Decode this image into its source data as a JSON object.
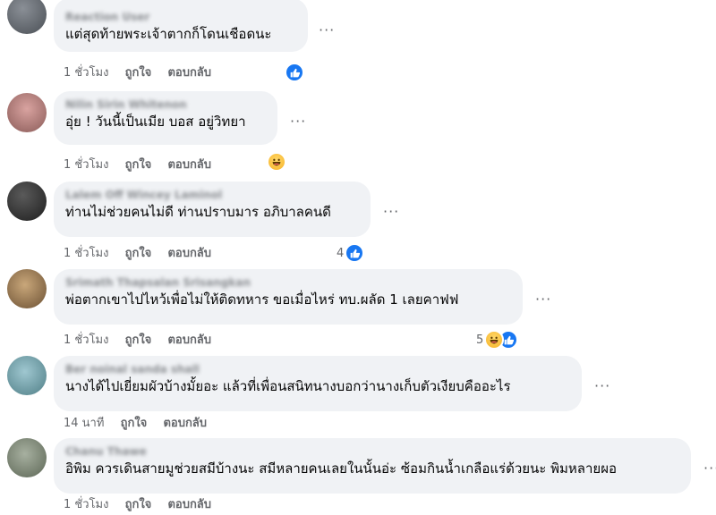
{
  "comments": [
    {
      "author": "Reaction User",
      "text": "แต่สุดท้ายพระเจ้าตากก็โดนเชือดนะ",
      "time": "1 ชั่วโมง",
      "like_label": "ถูกใจ",
      "reply_label": "ตอบกลับ",
      "reaction_count": "",
      "reactions": [
        "like"
      ]
    },
    {
      "author": "Nilin Sirin Whitenon",
      "text": "อุ่ย ! วันนี้เป็นเมีย บอส อยู่วิทยา",
      "time": "1 ชั่วโมง",
      "like_label": "ถูกใจ",
      "reply_label": "ตอบกลับ",
      "reaction_count": "",
      "reactions": [
        "haha"
      ]
    },
    {
      "author": "Lalem Off Wincey Laminol",
      "text": "ท่านไม่ช่วยคนไม่ดี ท่านปราบมาร อภิบาลคนดี",
      "time": "1 ชั่วโมง",
      "like_label": "ถูกใจ",
      "reply_label": "ตอบกลับ",
      "reaction_count": "4",
      "reactions": [
        "like"
      ]
    },
    {
      "author": "Srimath Thapsalan Srisangkan",
      "text": "พ่อตากเขาไปไหว้เพื่อไม่ให้ติดทหาร ขอเมื่อไหร่ ทบ.ผลัด 1 เลยคาฟฟ",
      "time": "1 ชั่วโมง",
      "like_label": "ถูกใจ",
      "reply_label": "ตอบกลับ",
      "reaction_count": "5",
      "reactions": [
        "haha",
        "like"
      ]
    },
    {
      "author": "Ber noinal sanda shall",
      "text": "นางได้ไปเยี่ยมผัวบ้างมั้ยอะ แล้วที่เพื่อนสนิทนางบอกว่านางเก็บตัวเงียบคืออะไร",
      "time": "14 นาที",
      "like_label": "ถูกใจ",
      "reply_label": "ตอบกลับ",
      "reaction_count": "",
      "reactions": []
    },
    {
      "author": "Chanu Thawe",
      "text": "อิพิม ควรเดินสายมูช่วยสมีบ้างนะ สมีหลายคนเลยในนั้นอ่ะ ซ้อมกินน้ำเกลือแร่ด้วยนะ พิมหลายผอ",
      "time": "1 ชั่วโมง",
      "like_label": "ถูกใจ",
      "reply_label": "ตอบกลับ",
      "reaction_count": "",
      "reactions": []
    }
  ],
  "more_label": "···",
  "colors": {
    "bubble": "#f0f2f5",
    "like": "#1877f2",
    "haha": "#f7b125",
    "meta": "#65676b"
  }
}
